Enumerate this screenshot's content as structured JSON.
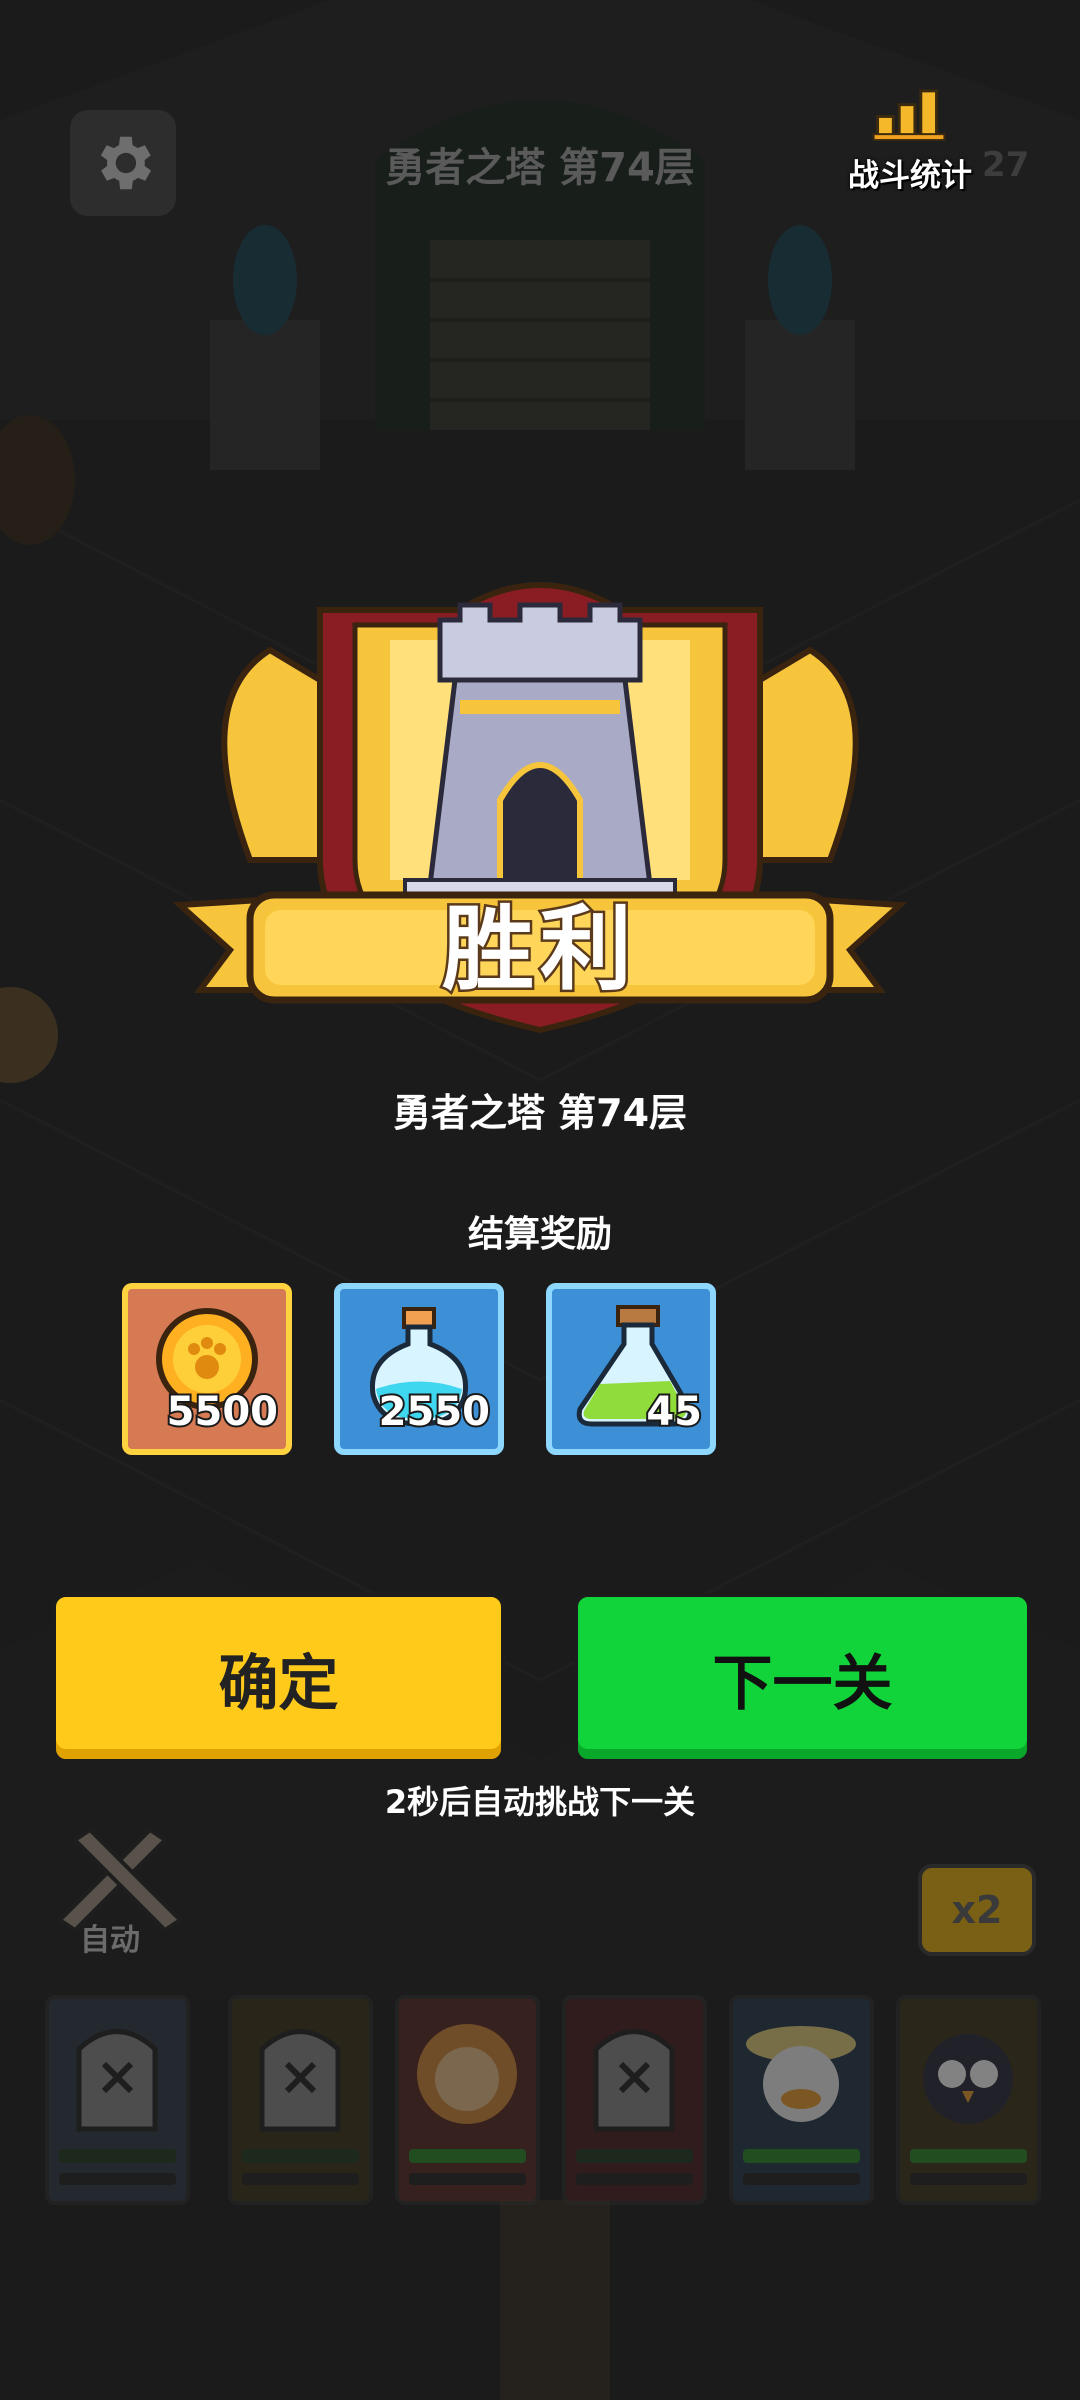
{
  "hud": {
    "stage_title": "勇者之塔 第74层",
    "stats_label": "战斗统计",
    "stats_count": "27"
  },
  "result": {
    "victory_text": "胜利",
    "stage_name": "勇者之塔 第74层",
    "rewards_title": "结算奖励",
    "rewards": [
      {
        "icon": "gold-coin-icon",
        "amount": "5500",
        "bg": "#d57a52",
        "border": "#ffd23f"
      },
      {
        "icon": "blue-potion-icon",
        "amount": "2550",
        "bg": "#3d8fd6",
        "border": "#8ed8ff"
      },
      {
        "icon": "green-potion-icon",
        "amount": "45",
        "bg": "#3d8fd6",
        "border": "#8ed8ff"
      }
    ]
  },
  "buttons": {
    "confirm_label": "确定",
    "next_label": "下一关",
    "auto_next_text": "2秒后自动挑战下一关"
  },
  "bottom_bar": {
    "auto_label": "自动",
    "speed_label": "x2",
    "heroes": [
      {
        "name": "hero-slot-1",
        "state": "defeated",
        "bg": "#2f3a48"
      },
      {
        "name": "hero-slot-2",
        "state": "defeated",
        "bg": "#3a3418"
      },
      {
        "name": "hero-slot-3",
        "state": "alive",
        "bg": "#5a2a22",
        "hp": 0.95
      },
      {
        "name": "hero-slot-4",
        "state": "defeated",
        "bg": "#4a1e1e"
      },
      {
        "name": "hero-slot-5",
        "state": "alive",
        "bg": "#24384a",
        "hp": 0.9
      },
      {
        "name": "hero-slot-6",
        "state": "alive",
        "bg": "#3d3418",
        "hp": 0.92
      }
    ]
  },
  "colors": {
    "gold": "#ffca1a",
    "green": "#11d43a",
    "badge_gold": "#f6c53c"
  }
}
